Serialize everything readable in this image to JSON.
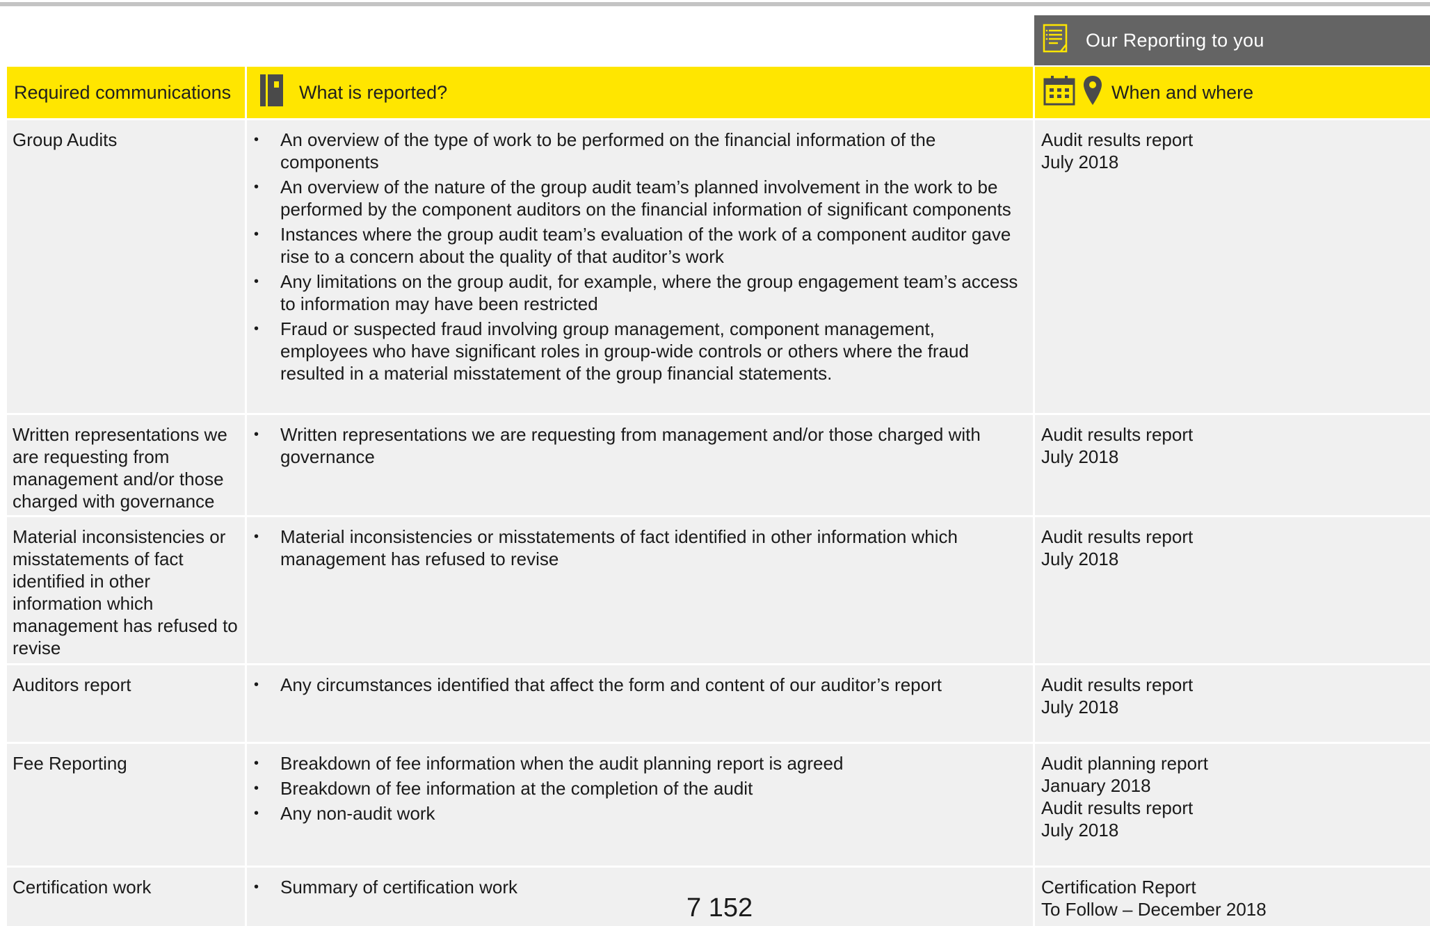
{
  "banner": {
    "title": "Our Reporting to you",
    "icon": "checklist-icon"
  },
  "headers": {
    "col1": "Required communications",
    "col2": "What is reported?",
    "col3": "When and where",
    "col2_icon": "notebook-icon",
    "col3_icons": [
      "calendar-icon",
      "location-pin-icon"
    ]
  },
  "rows": [
    {
      "requirement": "Group Audits",
      "items": [
        "An overview of the type of work to be performed on the financial information of the components",
        "An overview of the nature of the group audit team’s planned involvement in the work to be performed by the component auditors on the financial information of significant components",
        "Instances where the group audit team’s evaluation of the work of a component auditor gave rise to a concern about the quality of that auditor’s work",
        "Any limitations on the group audit, for example, where the group engagement team’s access to information may have been restricted",
        "Fraud or suspected fraud involving group management, component management, employees who have significant roles in group-wide controls or others where the fraud resulted in a material misstatement of the group financial statements."
      ],
      "when": "Audit results report\nJuly 2018"
    },
    {
      "requirement": "Written representations we are requesting from management and/or those charged with governance",
      "items": [
        "Written representations we are requesting from management and/or those charged with governance"
      ],
      "when": "Audit results report\nJuly 2018"
    },
    {
      "requirement": "Material inconsistencies or misstatements of fact identified in other information which management has refused to revise",
      "items": [
        "Material inconsistencies or misstatements of fact identified in other information which management has refused to revise"
      ],
      "when": "Audit results report\nJuly 2018"
    },
    {
      "requirement": "Auditors report",
      "items": [
        "Any circumstances identified that affect the form and content of our auditor’s report"
      ],
      "when": "Audit results report\nJuly 2018"
    },
    {
      "requirement": "Fee Reporting",
      "items": [
        "Breakdown of fee information when the  audit planning report is agreed",
        "Breakdown of fee information at the completion of the audit",
        "Any non-audit work"
      ],
      "when": "Audit planning report\nJanuary 2018\nAudit results report\nJuly 2018"
    },
    {
      "requirement": "Certification work",
      "items": [
        "Summary of certification work"
      ],
      "when": "Certification Report\nTo Follow – December 2018"
    }
  ],
  "page_number": "7 152",
  "colors": {
    "yellow": "#ffe600",
    "banner_grey": "#646464",
    "cell_grey": "#f0f0f0"
  }
}
